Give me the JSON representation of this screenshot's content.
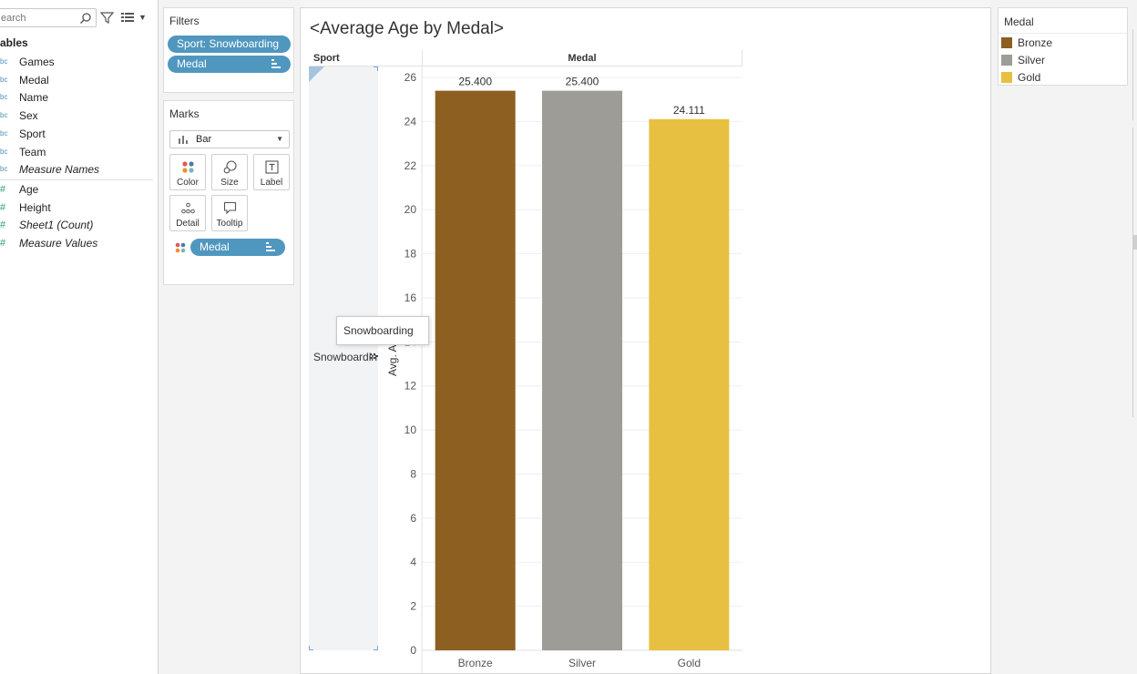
{
  "data_pane": {
    "search_placeholder": "earch",
    "tables_heading": "ables",
    "dimensions": [
      {
        "type": "bc",
        "name": "Games"
      },
      {
        "type": "bc",
        "name": "Medal"
      },
      {
        "type": "bc",
        "name": "Name"
      },
      {
        "type": "bc",
        "name": "Sex"
      },
      {
        "type": "bc",
        "name": "Sport"
      },
      {
        "type": "bc",
        "name": "Team"
      },
      {
        "type": "bc",
        "name": "Measure Names"
      }
    ],
    "measures": [
      {
        "type": "#",
        "name": "Age"
      },
      {
        "type": "#",
        "name": "Height"
      },
      {
        "type": "#",
        "name": "Sheet1 (Count)"
      },
      {
        "type": "#",
        "name": "Measure Values"
      }
    ]
  },
  "filters": {
    "title": "Filters",
    "pills": [
      "Sport: Snowboarding",
      "Medal"
    ]
  },
  "marks": {
    "title": "Marks",
    "mark_type": "Bar",
    "buttons": [
      "Color",
      "Size",
      "Label",
      "Detail",
      "Tooltip"
    ],
    "color_pill": "Medal"
  },
  "canvas": {
    "title": "<Average Age by Medal>",
    "row_header": "Sport",
    "column_header": "Medal",
    "row_value": "Snowboarding",
    "tooltip": "Snowboarding",
    "y_axis_title": "Avg. Age"
  },
  "legend": {
    "title": "Medal",
    "items": [
      {
        "label": "Bronze",
        "color": "#8d5f21"
      },
      {
        "label": "Silver",
        "color": "#9d9c97"
      },
      {
        "label": "Gold",
        "color": "#e8c041"
      }
    ]
  },
  "chart_data": {
    "type": "bar",
    "title": "<Average Age by Medal>",
    "xlabel": "Medal",
    "ylabel": "Avg. Age",
    "categories": [
      "Bronze",
      "Silver",
      "Gold"
    ],
    "values": [
      25.4,
      25.4,
      24.111
    ],
    "value_labels": [
      "25.400",
      "25.400",
      "24.111"
    ],
    "colors": [
      "#8d5f21",
      "#9d9c97",
      "#e8c041"
    ],
    "ylim": [
      0,
      26.5
    ],
    "yticks": [
      0,
      2,
      4,
      6,
      8,
      10,
      12,
      14,
      16,
      18,
      20,
      22,
      24,
      26
    ],
    "grid": true
  }
}
